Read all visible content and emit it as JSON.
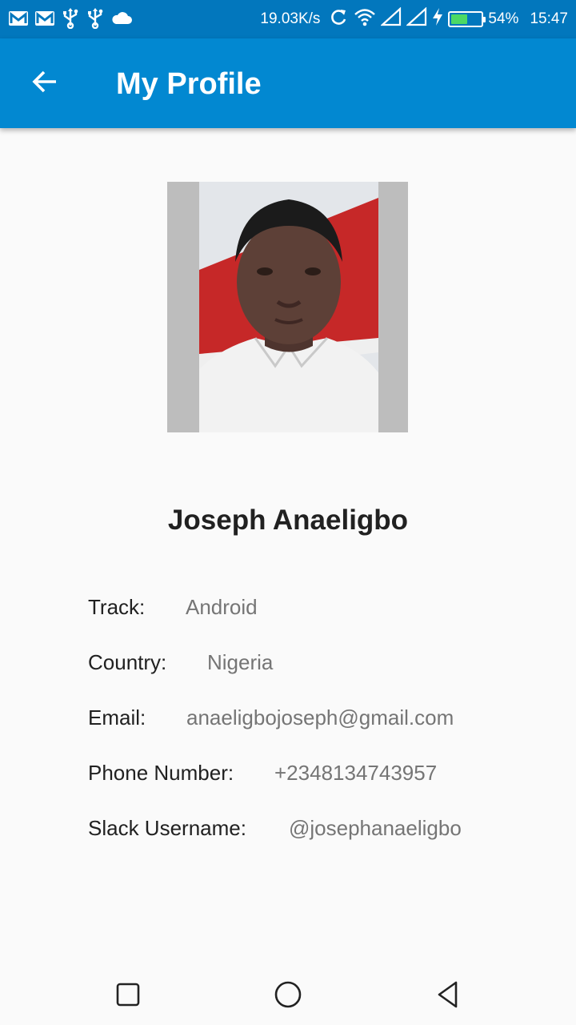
{
  "status_bar": {
    "network_speed": "19.03K/s",
    "battery_percent": "54%",
    "battery_level": 0.54,
    "time": "15:47",
    "icons": [
      "gmail-icon",
      "gmail-icon",
      "usb-icon",
      "usb-icon",
      "cloud-icon",
      "sync-icon",
      "wifi-icon",
      "signal-icon",
      "signal-icon",
      "charging-icon",
      "battery-icon"
    ]
  },
  "app_bar": {
    "title": "My Profile",
    "back_icon": "arrow-back-icon",
    "background": "#0288d1"
  },
  "profile": {
    "name": "Joseph Anaeligbo",
    "fields": [
      {
        "label": "Track:",
        "value": "Android"
      },
      {
        "label": "Country:",
        "value": "Nigeria"
      },
      {
        "label": "Email:",
        "value": "anaeligbojoseph@gmail.com"
      },
      {
        "label": "Phone Number:",
        "value": "+2348134743957"
      },
      {
        "label": "Slack Username:",
        "value": "@josephanaeligbo"
      }
    ]
  },
  "nav_bar": {
    "icons": [
      "recents-icon",
      "home-icon",
      "back-icon"
    ]
  },
  "colors": {
    "status_bar": "#0277bd",
    "app_bar": "#0288d1",
    "label_text": "#212121",
    "value_text": "#757575"
  }
}
